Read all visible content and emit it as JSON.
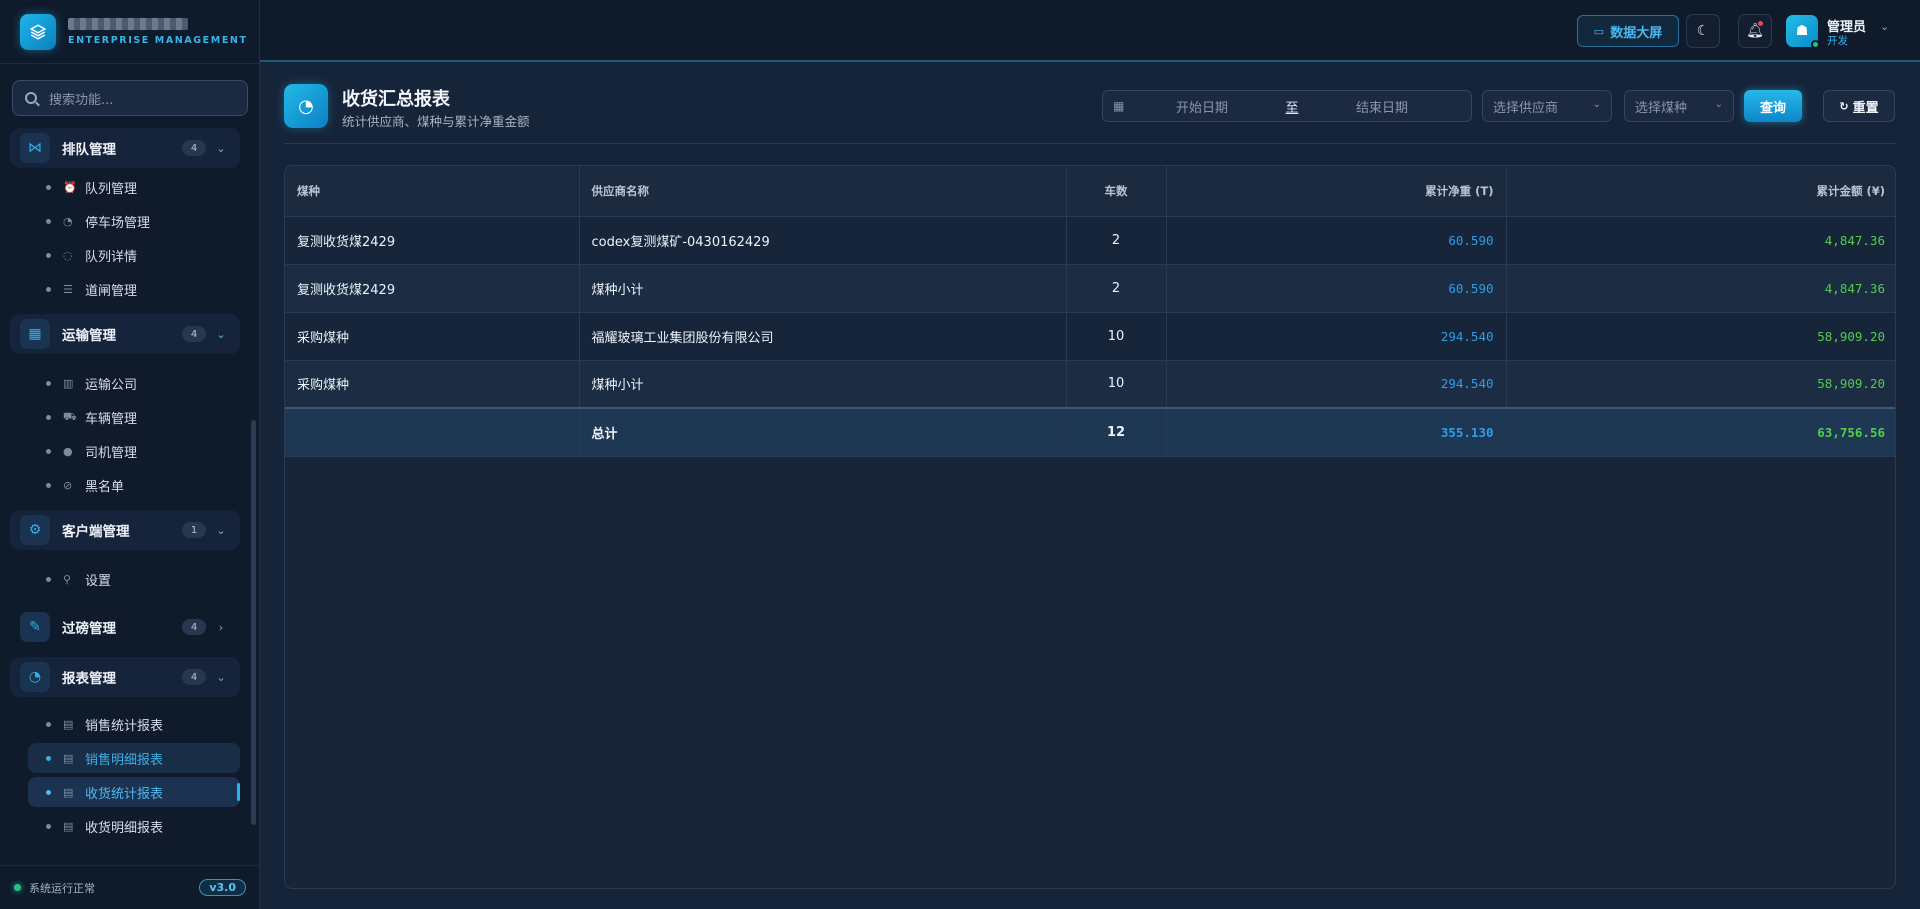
{
  "brand": {
    "subtitle": "ENTERPRISE MANAGEMENT"
  },
  "sidebar": {
    "search_placeholder": "搜索功能...",
    "groups": [
      {
        "label": "排队管理",
        "badge": "4",
        "open": true,
        "items": [
          {
            "label": "队列管理"
          },
          {
            "label": "停车场管理"
          },
          {
            "label": "队列详情"
          },
          {
            "label": "道闸管理"
          }
        ]
      },
      {
        "label": "运输管理",
        "badge": "4",
        "open": true,
        "items": [
          {
            "label": "运输公司"
          },
          {
            "label": "车辆管理"
          },
          {
            "label": "司机管理"
          },
          {
            "label": "黑名单"
          }
        ]
      },
      {
        "label": "客户端管理",
        "badge": "1",
        "open": true,
        "items": [
          {
            "label": "设置"
          }
        ]
      },
      {
        "label": "过磅管理",
        "badge": "4",
        "open": false,
        "items": []
      },
      {
        "label": "报表管理",
        "badge": "4",
        "open": true,
        "items": [
          {
            "label": "销售统计报表"
          },
          {
            "label": "销售明细报表"
          },
          {
            "label": "收货统计报表"
          },
          {
            "label": "收货明细报表"
          }
        ]
      }
    ],
    "status_text": "系统运行正常",
    "version": "v3.0"
  },
  "topbar": {
    "data_screen_label": "数据大屏",
    "user_name": "管理员",
    "user_role": "开发"
  },
  "page": {
    "title": "收货汇总报表",
    "subtitle": "统计供应商、煤种与累计净重金额"
  },
  "filters": {
    "start_placeholder": "开始日期",
    "separator": "至",
    "end_placeholder": "结束日期",
    "supplier_placeholder": "选择供应商",
    "coal_placeholder": "选择煤种",
    "query_label": "查询",
    "reset_label": "重置"
  },
  "table": {
    "headers": {
      "coal": "煤种",
      "supplier": "供应商名称",
      "trucks": "车数",
      "weight": "累计净重 (T)",
      "amount": "累计金额 (¥)"
    },
    "rows": [
      {
        "coal": "复测收货煤2429",
        "supplier": "codex复测煤矿-0430162429",
        "trucks": "2",
        "weight": "60.590",
        "amount": "4,847.36"
      },
      {
        "coal": "复测收货煤2429",
        "supplier": "煤种小计",
        "trucks": "2",
        "weight": "60.590",
        "amount": "4,847.36"
      },
      {
        "coal": "采购煤种",
        "supplier": "福耀玻璃工业集团股份有限公司",
        "trucks": "10",
        "weight": "294.540",
        "amount": "58,909.20"
      },
      {
        "coal": "采购煤种",
        "supplier": "煤种小计",
        "trucks": "10",
        "weight": "294.540",
        "amount": "58,909.20"
      }
    ],
    "total": {
      "coal": "",
      "supplier": "总计",
      "trucks": "12",
      "weight": "355.130",
      "amount": "63,756.56"
    }
  },
  "colors": {
    "accent": "#21b9e8",
    "weight": "#2f9ee6",
    "amount": "#52cc4e",
    "online": "#27c087"
  }
}
